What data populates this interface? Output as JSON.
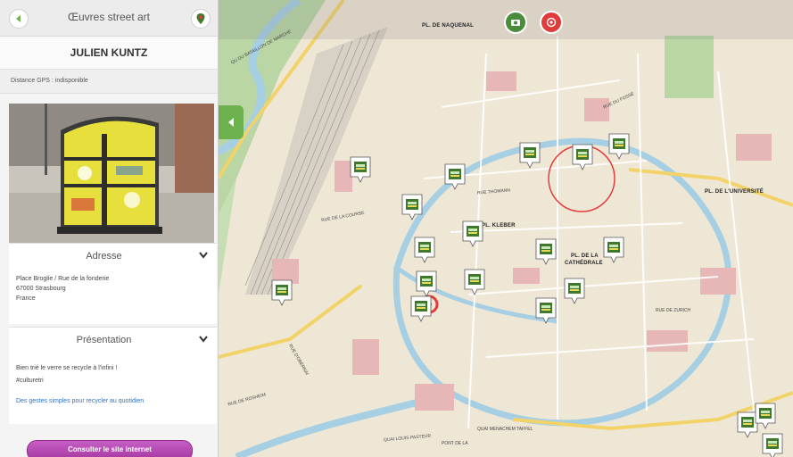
{
  "app": {
    "title": "Œuvres street art"
  },
  "artist": {
    "name": "JULIEN KUNTZ"
  },
  "gps": {
    "text": "Distance GPS : indisponible"
  },
  "address": {
    "header": "Adresse",
    "line1": "Place Broglie / Rue de la fonderie",
    "line2": "67000 Strasbourg",
    "line3": "France"
  },
  "presentation": {
    "header": "Présentation",
    "text": "Bien trié le verre se recycle à l'infini !",
    "tag": "#culturetri",
    "link": "Des gestes simples pour recycler au quotidien"
  },
  "actions": {
    "website_button": "Consulter le site internet"
  },
  "map": {
    "places": {
      "naquenal": "PL. DE NAQUENAL",
      "kleber": "PL. KLEBER",
      "cathedrale_1": "PL. DE LA",
      "cathedrale_2": "CATHÉDRALE",
      "universite": "PL. DE L'UNIVERSITÉ"
    },
    "streets": {
      "s1": "QU DU BATAILLON DE MARCHE",
      "s2": "RUE DE LA COURSE",
      "s3": "RUE DU FOSSÉ",
      "s4": "QUAI LOUIS PASTEUR",
      "s5": "QUAI MENACHEM TAFFEL",
      "s6": "RUE DE ZURICH",
      "s7": "RUE D'OBERNAI",
      "s8": "PONT DE LA",
      "s9": "RUE DE ROSHEIM",
      "s10": "RUE THOMANN"
    }
  },
  "colors": {
    "accent_green": "#6cb14e",
    "marker_green": "#3f7a2c",
    "button_purple": "#b14aad",
    "highlight_red": "#e03c3c"
  }
}
